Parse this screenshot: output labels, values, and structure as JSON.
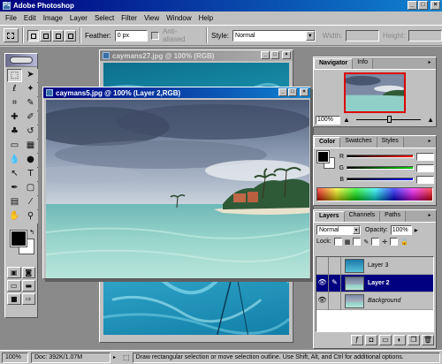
{
  "app": {
    "title": "Adobe Photoshop"
  },
  "window_buttons": {
    "minimize": "_",
    "maximize": "□",
    "close": "×"
  },
  "menu": [
    "File",
    "Edit",
    "Image",
    "Layer",
    "Select",
    "Filter",
    "View",
    "Window",
    "Help"
  ],
  "options_bar": {
    "feather_label": "Feather:",
    "feather_value": "0 px",
    "antialias_label": "Anti-aliased",
    "style_label": "Style:",
    "style_value": "Normal",
    "width_label": "Width:",
    "height_label": "Height:"
  },
  "documents": {
    "back": {
      "title": "caymans27.jpg @ 100% (RGB)"
    },
    "front": {
      "title": "caymans5.jpg @ 100% (Layer 2,RGB)"
    }
  },
  "navigator": {
    "tabs": [
      "Navigator",
      "Info"
    ],
    "active_tab": "Navigator",
    "zoom": "100%"
  },
  "color_palette": {
    "tabs": [
      "Color",
      "Swatches",
      "Styles"
    ],
    "active_tab": "Color",
    "channels": [
      {
        "label": "R",
        "value": "",
        "color": "#c02020"
      },
      {
        "label": "G",
        "value": "",
        "color": "#20a040"
      },
      {
        "label": "B",
        "value": "",
        "color": "#2040c0"
      }
    ]
  },
  "layers_palette": {
    "tabs": [
      "Layers",
      "Channels",
      "Paths"
    ],
    "active_tab": "Layers",
    "blend_mode": "Normal",
    "opacity_label": "Opacity:",
    "opacity_value": "100%",
    "lock_label": "Lock:",
    "layers": [
      {
        "name": "Layer 3",
        "visible": false,
        "selected": false
      },
      {
        "name": "Layer 2",
        "visible": true,
        "selected": true
      },
      {
        "name": "Background",
        "visible": true,
        "selected": false
      }
    ]
  },
  "status_bar": {
    "zoom": "100%",
    "doc_info": "Doc: 392K/1.07M",
    "message": "Draw rectangular selection or move selection outline. Use Shift, Alt, and Ctrl for additional options."
  },
  "colors": {
    "title_active": "#000080",
    "workspace": "#8a8a8a",
    "selected_layer": "#000080"
  }
}
